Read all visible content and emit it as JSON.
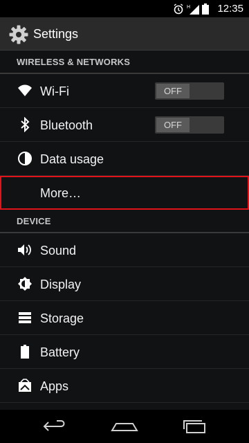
{
  "status_bar": {
    "time": "12:35",
    "icons": [
      "alarm-icon",
      "signal-icon",
      "battery-icon"
    ]
  },
  "action_bar": {
    "title": "Settings",
    "icon": "settings-gear-icon"
  },
  "sections": [
    {
      "header": "WIRELESS & NETWORKS",
      "items": [
        {
          "label": "Wi-Fi",
          "icon": "wifi-icon",
          "toggle": "OFF"
        },
        {
          "label": "Bluetooth",
          "icon": "bluetooth-icon",
          "toggle": "OFF"
        },
        {
          "label": "Data usage",
          "icon": "data-usage-icon"
        },
        {
          "label": "More…",
          "highlighted": true
        }
      ]
    },
    {
      "header": "DEVICE",
      "items": [
        {
          "label": "Sound",
          "icon": "sound-icon"
        },
        {
          "label": "Display",
          "icon": "display-icon"
        },
        {
          "label": "Storage",
          "icon": "storage-icon"
        },
        {
          "label": "Battery",
          "icon": "battery-icon"
        },
        {
          "label": "Apps",
          "icon": "apps-icon"
        }
      ]
    }
  ],
  "colors": {
    "highlight_border": "#e0121a",
    "background": "#111214"
  },
  "nav_bar": {
    "buttons": [
      "back-icon",
      "home-icon",
      "recents-icon"
    ]
  }
}
